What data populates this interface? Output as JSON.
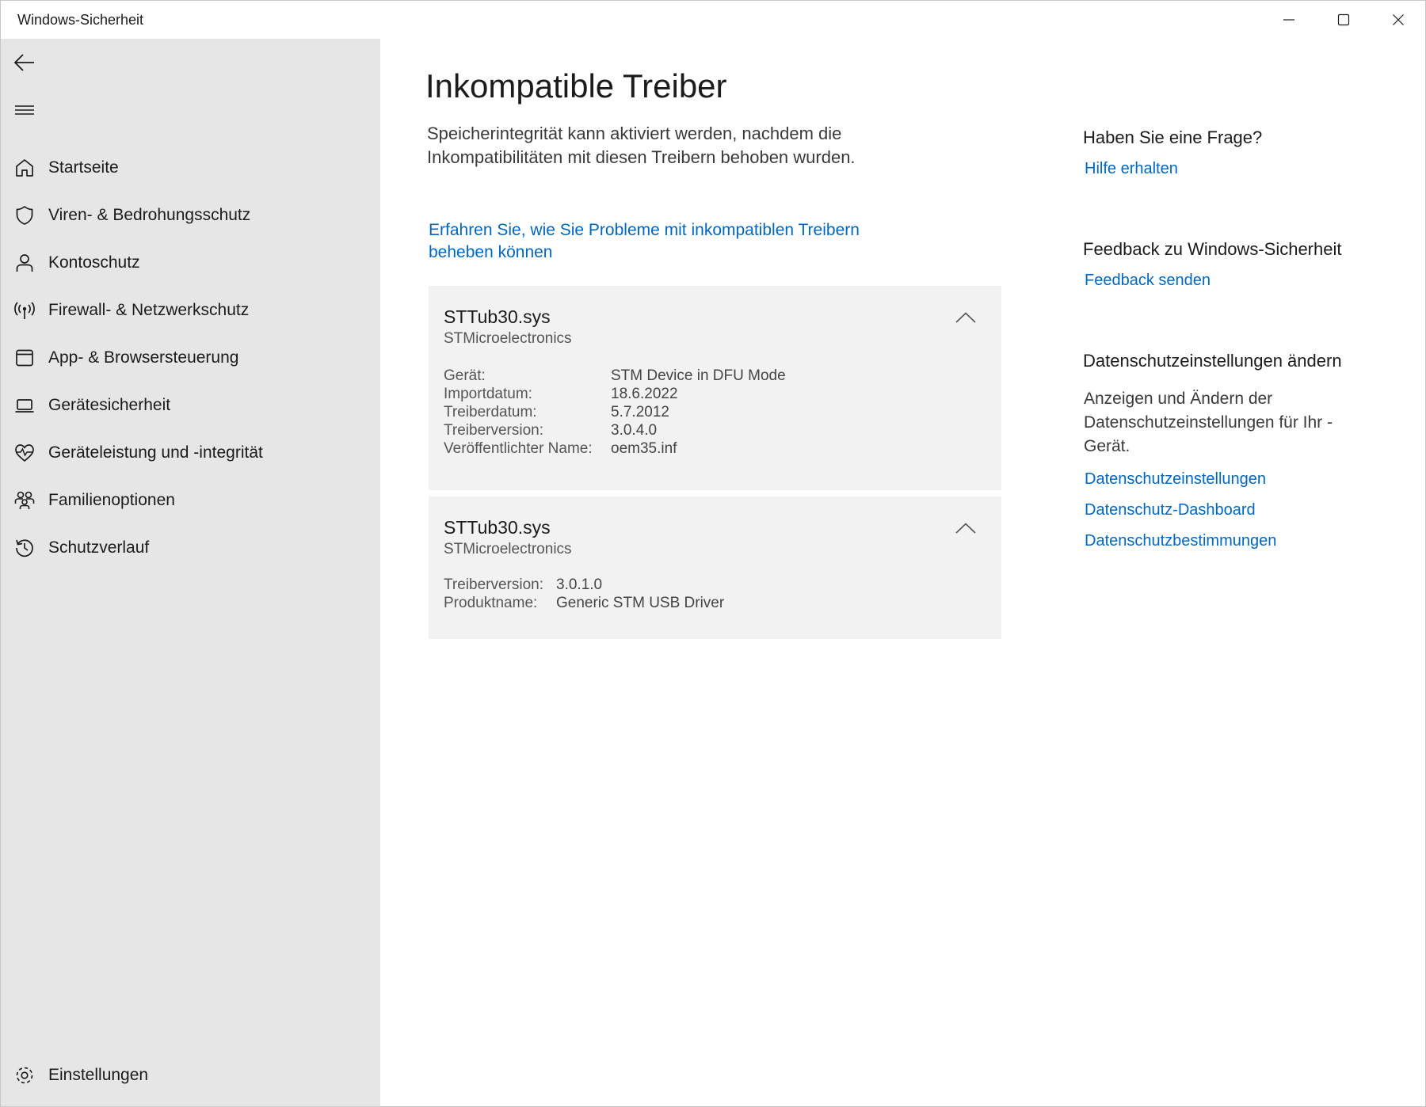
{
  "window": {
    "title": "Windows-Sicherheit"
  },
  "sidebar": {
    "items": [
      {
        "label": "Startseite",
        "icon": "home-icon"
      },
      {
        "label": "Viren- & Bedrohungsschutz",
        "icon": "shield-icon"
      },
      {
        "label": "Kontoschutz",
        "icon": "person-icon"
      },
      {
        "label": "Firewall- & Netzwerkschutz",
        "icon": "wireless-icon"
      },
      {
        "label": "App- & Browsersteuerung",
        "icon": "app-window-icon"
      },
      {
        "label": "Gerätesicherheit",
        "icon": "laptop-icon"
      },
      {
        "label": "Geräteleistung und -integrität",
        "icon": "heart-pulse-icon"
      },
      {
        "label": "Familienoptionen",
        "icon": "family-icon"
      },
      {
        "label": "Schutzverlauf",
        "icon": "history-icon"
      }
    ],
    "settings": {
      "label": "Einstellungen",
      "icon": "gear-icon"
    }
  },
  "main": {
    "title": "Inkompatible Treiber",
    "description": "Speicherintegrität kann aktiviert werden, nachdem die Inkompatibilitäten mit diesen Treibern behoben wurden.",
    "learn_link": "Erfahren Sie, wie Sie Probleme mit inkompatiblen Treibern beheben können",
    "drivers": [
      {
        "name": "STTub30.sys",
        "vendor": "STMicroelectronics",
        "details": [
          {
            "key": "Gerät:",
            "value": "STM Device in DFU Mode"
          },
          {
            "key": "Importdatum:",
            "value": "18.6.2022"
          },
          {
            "key": "Treiberdatum:",
            "value": "5.7.2012"
          },
          {
            "key": "Treiberversion:",
            "value": "3.0.4.0"
          },
          {
            "key": "Veröffentlichter Name:",
            "value": "oem35.inf"
          }
        ]
      },
      {
        "name": "STTub30.sys",
        "vendor": "STMicroelectronics",
        "details": [
          {
            "key": "Treiberversion:",
            "value": "3.0.1.0"
          },
          {
            "key": "Produktname:",
            "value": "Generic STM USB Driver"
          }
        ]
      }
    ]
  },
  "right_panel": {
    "question": {
      "heading": "Haben Sie eine Frage?",
      "link": "Hilfe erhalten"
    },
    "feedback": {
      "heading": "Feedback zu Windows-Sicherheit",
      "link": "Feedback senden"
    },
    "privacy": {
      "heading": "Datenschutzeinstellungen ändern",
      "text": "Anzeigen und Ändern der Datenschutzeinstellungen für Ihr -Gerät.",
      "links": [
        "Datenschutzeinstellungen",
        "Datenschutz-Dashboard",
        "Datenschutzbestimmungen"
      ]
    }
  },
  "colors": {
    "sidebar_bg": "#e6e6e6",
    "card_bg": "#f2f2f2",
    "link": "#0067c0"
  }
}
